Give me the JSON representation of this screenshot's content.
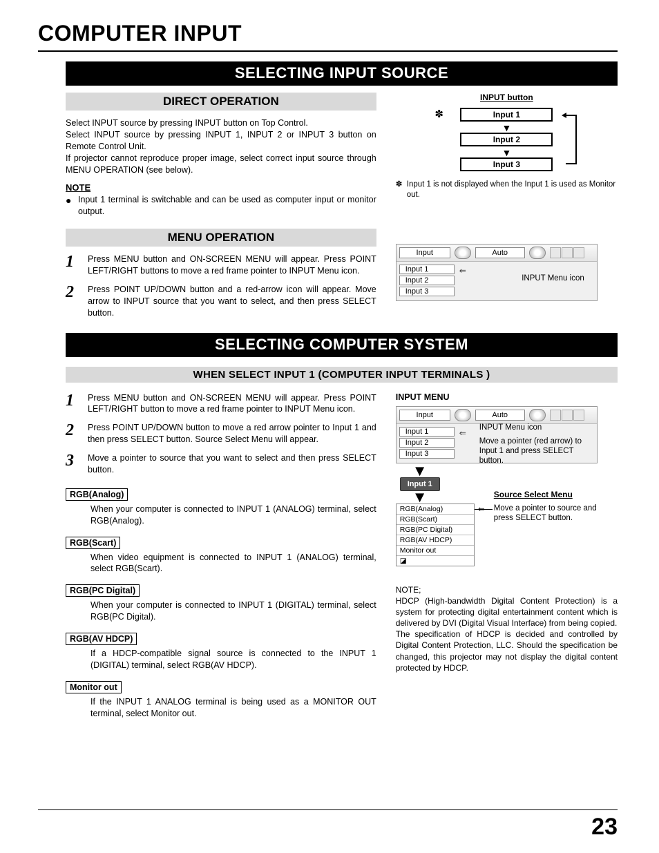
{
  "page": {
    "title": "COMPUTER INPUT",
    "number": "23"
  },
  "section1": {
    "bar": "SELECTING INPUT SOURCE",
    "direct": {
      "heading": "DIRECT OPERATION",
      "p1": "Select INPUT source by pressing INPUT button on Top Control.",
      "p2": "Select INPUT source by pressing INPUT 1, INPUT 2 or INPUT 3 button on Remote Control Unit.",
      "p3": "If projector cannot reproduce proper image, select correct input source through MENU OPERATION (see below).",
      "note_h": "NOTE",
      "note_item": "Input 1 terminal is switchable and can be used as computer input or monitor output."
    },
    "input_button": {
      "caption": "INPUT button",
      "b1": "Input 1",
      "b2": "Input 2",
      "b3": "Input 3",
      "asterisk": "✽",
      "asterisk_note": "Input 1 is not displayed when the Input 1 is used as Monitor out."
    },
    "menu": {
      "heading": "MENU OPERATION",
      "step1": "Press MENU button and ON-SCREEN MENU will appear.  Press POINT LEFT/RIGHT buttons to move a red frame pointer to INPUT Menu icon.",
      "step2": "Press POINT UP/DOWN button and a red-arrow icon will appear.  Move arrow to INPUT source that you want to select, and then press SELECT button.",
      "osd": {
        "tab": "Input",
        "auto": "Auto",
        "items": [
          "Input 1",
          "Input 2",
          "Input 3"
        ],
        "label": "INPUT Menu icon"
      }
    }
  },
  "section2": {
    "bar": "SELECTING COMPUTER SYSTEM",
    "subbar": "WHEN SELECT  INPUT 1 (COMPUTER INPUT TERMINALS )",
    "steps": {
      "s1": "Press MENU button and ON-SCREEN MENU will appear.  Press POINT LEFT/RIGHT button to move a red frame pointer to INPUT Menu icon.",
      "s2": "Press POINT UP/DOWN button to move a red arrow pointer to Input 1 and then press SELECT button.  Source Select Menu will appear.",
      "s3": "Move a pointer to source that you want to select and then press SELECT button."
    },
    "modes": [
      {
        "label": "RGB(Analog)",
        "text": "When your computer is connected to INPUT 1 (ANALOG) terminal, select RGB(Analog)."
      },
      {
        "label": "RGB(Scart)",
        "text": "When video equipment is connected to INPUT 1 (ANALOG) terminal, select RGB(Scart)."
      },
      {
        "label": "RGB(PC Digital)",
        "text": "When your computer is connected to INPUT 1 (DIGITAL) terminal, select RGB(PC Digital)."
      },
      {
        "label": "RGB(AV HDCP)",
        "text": "If a HDCP-compatible signal source is connected to the INPUT 1 (DIGITAL) terminal, select RGB(AV HDCP)."
      },
      {
        "label": "Monitor out",
        "text": "If the INPUT 1 ANALOG terminal is being used as a MONITOR OUT terminal, select Monitor out."
      }
    ],
    "right": {
      "heading": "INPUT MENU",
      "osd_tab": "Input",
      "osd_auto": "Auto",
      "osd_items": [
        "Input 1",
        "Input 2",
        "Input 3"
      ],
      "label_menuicon": "INPUT Menu icon",
      "label_move": "Move a pointer (red arrow) to Input 1 and press SELECT button.",
      "pill": "Input 1",
      "src_heading": "Source Select Menu",
      "src_items": [
        "RGB(Analog)",
        "RGB(Scart)",
        "RGB(PC Digital)",
        "RGB(AV HDCP)",
        "Monitor out"
      ],
      "src_last_glyph": "◪",
      "label_src": "Move a pointer to source and press SELECT button.",
      "note_h": "NOTE;",
      "note_body": "HDCP (High-bandwidth Digital Content Protection) is a system for protecting digital entertainment content which is delivered by DVI (Digital Visual Interface) from being copied.\nThe specification of HDCP is decided and controlled by Digital Content Protection, LLC. Should the specification be changed, this projector may not display the digital content protected by HDCP."
    }
  }
}
